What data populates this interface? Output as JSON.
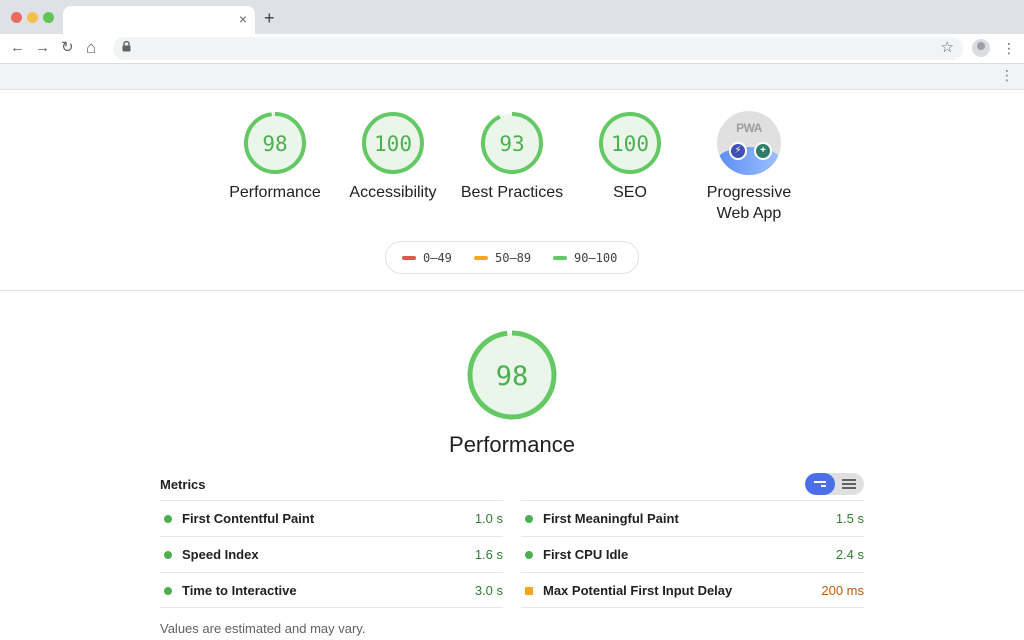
{
  "browser": {
    "tab_close": "×",
    "new_tab": "+",
    "nav": {
      "back": "←",
      "forward": "→",
      "reload": "↻",
      "home": "⌂"
    },
    "address": "",
    "icons": {
      "lock": "lock-icon",
      "star": "star-icon",
      "menu": "⋮"
    }
  },
  "summary": {
    "gauges": [
      {
        "id": "performance",
        "score": "98",
        "label": "Performance",
        "value": 0.98
      },
      {
        "id": "accessibility",
        "score": "100",
        "label": "Accessibility",
        "value": 1.0
      },
      {
        "id": "best-practices",
        "score": "93",
        "label": "Best Practices",
        "value": 0.93
      },
      {
        "id": "seo",
        "score": "100",
        "label": "SEO",
        "value": 1.0
      }
    ],
    "pwa": {
      "badge_text": "PWA",
      "label_line1": "Progressive",
      "label_line2": "Web App"
    },
    "legend": [
      {
        "range": "0–49",
        "color": "#e0574c"
      },
      {
        "range": "50–89",
        "color": "#f4a623"
      },
      {
        "range": "90–100",
        "color": "#64c864"
      }
    ]
  },
  "performance": {
    "score": "98",
    "value": 0.98,
    "title": "Performance",
    "metrics_heading": "Metrics",
    "metrics_left": [
      {
        "name": "First Contentful Paint",
        "value": "1.0 s",
        "status": "pass"
      },
      {
        "name": "Speed Index",
        "value": "1.6 s",
        "status": "pass"
      },
      {
        "name": "Time to Interactive",
        "value": "3.0 s",
        "status": "pass"
      }
    ],
    "metrics_right": [
      {
        "name": "First Meaningful Paint",
        "value": "1.5 s",
        "status": "pass"
      },
      {
        "name": "First CPU Idle",
        "value": "2.4 s",
        "status": "pass"
      },
      {
        "name": "Max Potential First Input Delay",
        "value": "200 ms",
        "status": "average"
      }
    ],
    "footnote": "Values are estimated and may vary."
  },
  "colors": {
    "pass": "#4caf50",
    "average": "#f4a623",
    "fail": "#e0574c",
    "toggle_active": "#4a6fe8"
  }
}
